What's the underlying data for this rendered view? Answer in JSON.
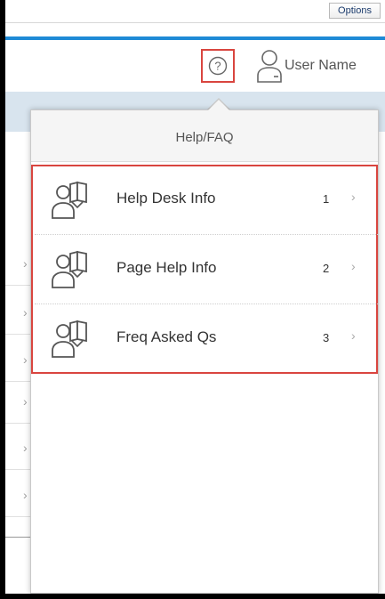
{
  "toolbar": {
    "options_label": "Options"
  },
  "shell": {
    "user_name": "User Name"
  },
  "popover": {
    "title": "Help/FAQ",
    "items": [
      {
        "label": "Help Desk Info",
        "count": "1",
        "icon": "help-book-user-icon"
      },
      {
        "label": "Page Help Info",
        "count": "2",
        "icon": "help-book-user-icon"
      },
      {
        "label": "Freq Asked Qs",
        "count": "3",
        "icon": "help-book-user-icon"
      }
    ]
  },
  "background": {
    "row_chevron": "›"
  },
  "colors": {
    "accent": "#1f8ad6",
    "highlight": "#d9453f",
    "band": "#d8e4ee"
  }
}
